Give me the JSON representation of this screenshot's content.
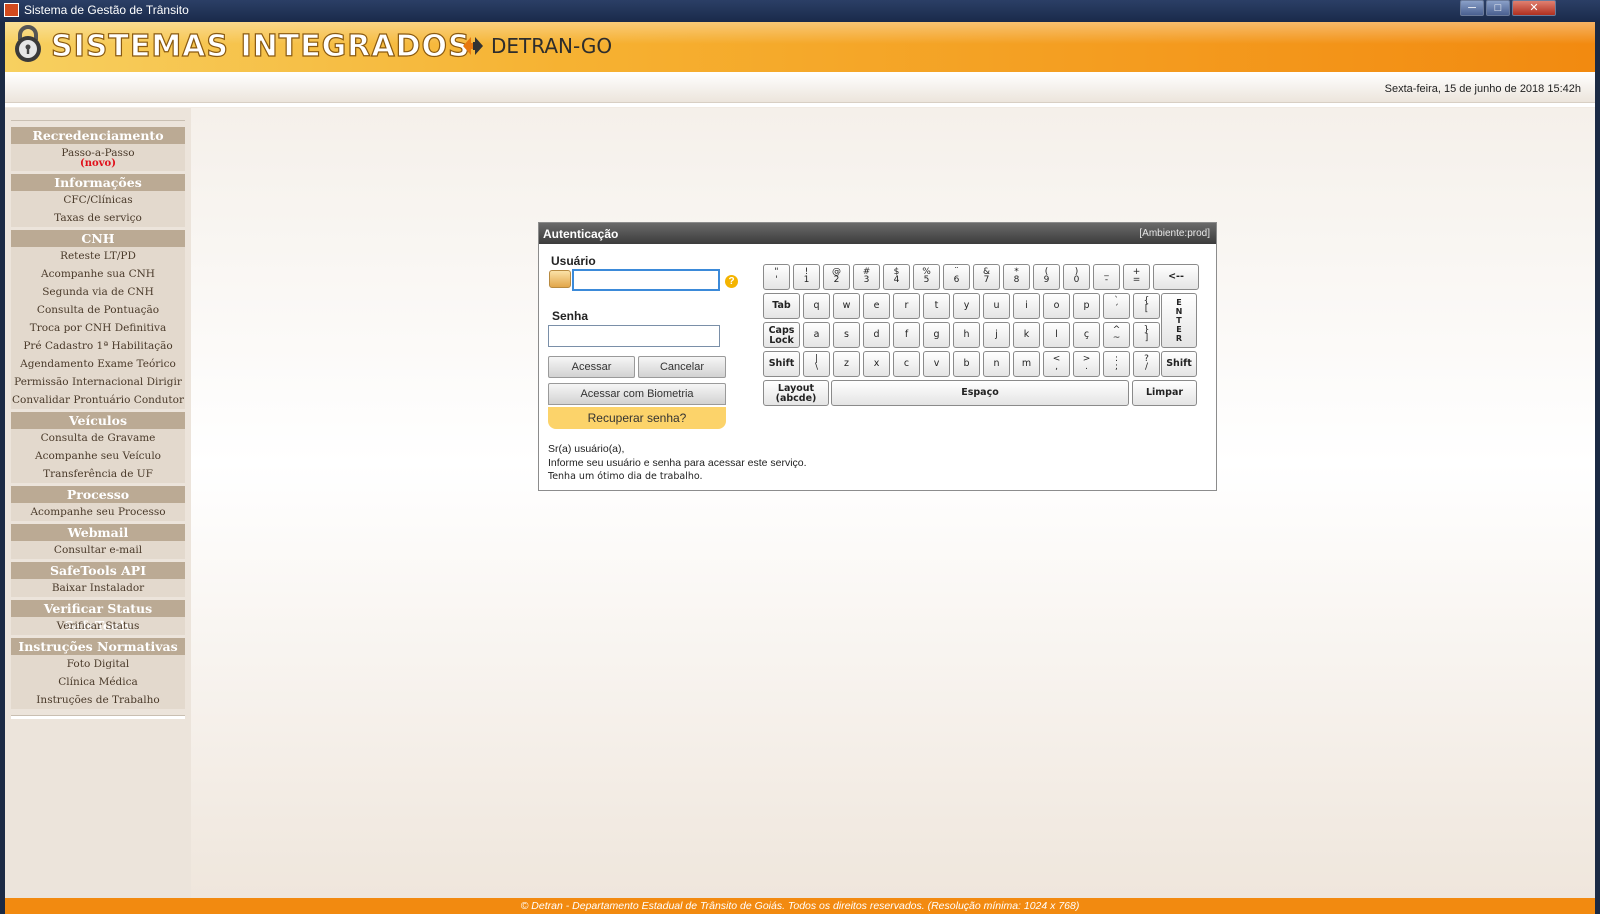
{
  "window": {
    "title": "Sistema de Gestão de Trânsito",
    "min": "─",
    "max": "□",
    "close": "✕"
  },
  "header": {
    "brand": "SISTEMAS INTEGRADOS",
    "detran": "DETRAN-GO",
    "datetime": "Sexta-feira, 15 de junho de 2018 15:42h"
  },
  "sidebar": {
    "groups": [
      {
        "title": "Recredenciamento",
        "items": [
          "Passo-a-Passo"
        ],
        "badge": "(novo)"
      },
      {
        "title": "Informações",
        "items": [
          "CFC/Clínicas",
          "Taxas de serviço"
        ]
      },
      {
        "title": "CNH",
        "items": [
          "Reteste LT/PD",
          "Acompanhe sua CNH",
          "Segunda via de CNH",
          "Consulta de Pontuação",
          "Troca por CNH Definitiva",
          "Pré Cadastro 1ª Habilitação",
          "Agendamento Exame Teórico",
          "Permissão Internacional Dirigir",
          "Convalidar Prontuário Condutor"
        ]
      },
      {
        "title": "Veículos",
        "items": [
          "Consulta de Gravame",
          "Acompanhe seu Veículo",
          "Transferência de UF"
        ]
      },
      {
        "title": "Processo",
        "items": [
          "Acompanhe seu Processo"
        ]
      },
      {
        "title": "Webmail",
        "items": [
          "Consultar e-mail"
        ]
      },
      {
        "title": "SafeTools API",
        "items": [
          "Baixar Instalador"
        ]
      },
      {
        "title": "Verificar Status SafeTools",
        "items": [
          "Verificar Status"
        ]
      },
      {
        "title": "Instruções Normativas",
        "items": [
          "Foto Digital",
          "Clínica Médica",
          "Instruções de Trabalho"
        ]
      }
    ]
  },
  "auth": {
    "title": "Autenticação",
    "env": "[Ambiente:prod]",
    "user_label": "Usuário",
    "user_value": "",
    "pass_label": "Senha",
    "pass_value": "",
    "help": "?",
    "btn_access": "Acessar",
    "btn_cancel": "Cancelar",
    "btn_biometric": "Acessar com Biometria",
    "recover": "Recuperar senha?",
    "message": [
      "Sr(a) usuário(a),",
      "Informe seu usuário e senha para acessar este serviço.",
      "Tenha um ótimo dia de trabalho."
    ]
  },
  "keyboard": {
    "row1": [
      [
        "\"",
        "'"
      ],
      [
        "!",
        "1"
      ],
      [
        "@",
        "2"
      ],
      [
        "#",
        "3"
      ],
      [
        "$",
        "4"
      ],
      [
        "%",
        "5"
      ],
      [
        "¨",
        "6"
      ],
      [
        "&",
        "7"
      ],
      [
        "*",
        "8"
      ],
      [
        "(",
        "9"
      ],
      [
        ")",
        "0"
      ],
      [
        "_",
        "-"
      ],
      [
        "+",
        "="
      ]
    ],
    "backspace": "<--",
    "tab": "Tab",
    "row2": [
      "q",
      "w",
      "e",
      "r",
      "t",
      "y",
      "u",
      "i",
      "o",
      "p"
    ],
    "row2_extra": [
      [
        "`",
        "´"
      ],
      [
        "{",
        "["
      ]
    ],
    "enter": "ENTER",
    "caps": [
      "Caps",
      "Lock"
    ],
    "row3": [
      "a",
      "s",
      "d",
      "f",
      "g",
      "h",
      "j",
      "k",
      "l",
      "ç"
    ],
    "row3_extra": [
      [
        "^",
        "~"
      ],
      [
        "}",
        "]"
      ]
    ],
    "shift": "Shift",
    "row4_first": [
      "|",
      "\\"
    ],
    "row4": [
      "z",
      "x",
      "c",
      "v",
      "b",
      "n",
      "m"
    ],
    "row4_extra": [
      [
        "<",
        ","
      ],
      [
        ">",
        "."
      ],
      [
        ":",
        ";"
      ],
      [
        "?",
        "/"
      ]
    ],
    "layout": [
      "Layout",
      "(abcde)"
    ],
    "space": "Espaço",
    "clear": "Limpar"
  },
  "footer": "© Detran - Departamento Estadual de Trânsito de Goiás. Todos os direitos reservados. (Resolução mínima: 1024 x 768)",
  "colors": {
    "accent_orange": "#f28a10",
    "sidebar_header": "#bbaa94",
    "novo_red": "#e0101a",
    "recover_yellow": "#fcd36a"
  }
}
